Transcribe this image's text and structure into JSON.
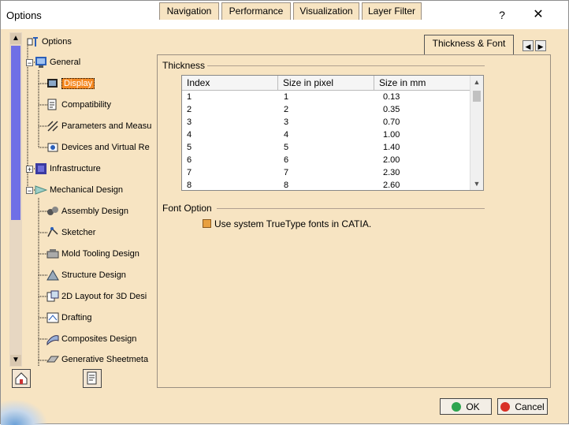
{
  "window": {
    "title": "Options",
    "help": "?",
    "close": "✕"
  },
  "tree": {
    "root": "Options",
    "items": [
      {
        "label": "General"
      },
      {
        "label": "Display",
        "selected": true
      },
      {
        "label": "Compatibility"
      },
      {
        "label": "Parameters and Measu"
      },
      {
        "label": "Devices and Virtual Re"
      },
      {
        "label": "Infrastructure"
      },
      {
        "label": "Mechanical Design"
      },
      {
        "label": "Assembly Design"
      },
      {
        "label": "Sketcher"
      },
      {
        "label": "Mold Tooling Design"
      },
      {
        "label": "Structure Design"
      },
      {
        "label": "2D Layout for 3D Desi"
      },
      {
        "label": "Drafting"
      },
      {
        "label": "Composites Design"
      },
      {
        "label": "Generative Sheetmeta"
      }
    ]
  },
  "tabs": [
    {
      "label": "Navigation"
    },
    {
      "label": "Performance"
    },
    {
      "label": "Visualization"
    },
    {
      "label": "Layer Filter"
    },
    {
      "label": "Thickness & Font",
      "active": true
    }
  ],
  "thickness": {
    "title": "Thickness",
    "columns": [
      "Index",
      "Size in pixel",
      "Size in mm"
    ],
    "rows": [
      [
        "1",
        "1",
        "0.13"
      ],
      [
        "2",
        "2",
        "0.35"
      ],
      [
        "3",
        "3",
        "0.70"
      ],
      [
        "4",
        "4",
        "1.00"
      ],
      [
        "5",
        "5",
        "1.40"
      ],
      [
        "6",
        "6",
        "2.00"
      ],
      [
        "7",
        "7",
        "2.30"
      ],
      [
        "8",
        "8",
        "2.60"
      ]
    ]
  },
  "font_option": {
    "title": "Font Option",
    "checkbox_label": "Use system TrueType fonts in CATIA.",
    "checked": false
  },
  "buttons": {
    "ok": "OK",
    "cancel": "Cancel"
  },
  "colors": {
    "accent": "#f58a23",
    "background": "#f7e4c2",
    "ok_dot": "#2ea44f",
    "cancel_dot": "#d93025"
  }
}
